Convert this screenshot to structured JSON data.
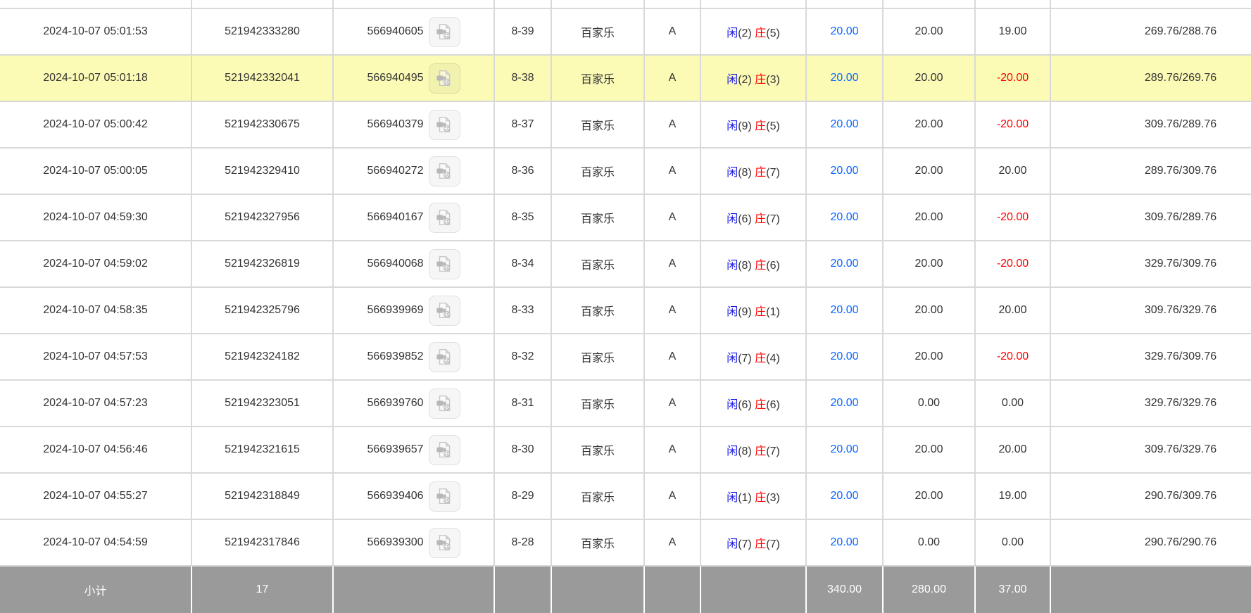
{
  "colors": {
    "highlight_row": "#fbfbb6",
    "bet_amount_blue": "#0a66ff",
    "player_blue": "#1414e6",
    "banker_red": "#ff0000",
    "negative_red": "#ff0000",
    "summary_bg": "#9a9a9a",
    "summary_text": "#ffffff",
    "grid_border": "#d9d9d9"
  },
  "icons": {
    "video_replay": "video-file-icon"
  },
  "table": {
    "rows": [
      {
        "time": "2024-10-07 05:01:53",
        "order_no": "521942333280",
        "game_no": "566940605",
        "round": "8-39",
        "game": "百家乐",
        "table": "A",
        "player_label": "闲",
        "player_score": "(2)",
        "banker_label": "庄",
        "banker_score": "(5)",
        "bet": "20.00",
        "valid": "20.00",
        "win_loss": "19.00",
        "balance": "269.76/288.76",
        "highlighted": false
      },
      {
        "time": "2024-10-07 05:01:18",
        "order_no": "521942332041",
        "game_no": "566940495",
        "round": "8-38",
        "game": "百家乐",
        "table": "A",
        "player_label": "闲",
        "player_score": "(2)",
        "banker_label": "庄",
        "banker_score": "(3)",
        "bet": "20.00",
        "valid": "20.00",
        "win_loss": "-20.00",
        "balance": "289.76/269.76",
        "highlighted": true
      },
      {
        "time": "2024-10-07 05:00:42",
        "order_no": "521942330675",
        "game_no": "566940379",
        "round": "8-37",
        "game": "百家乐",
        "table": "A",
        "player_label": "闲",
        "player_score": "(9)",
        "banker_label": "庄",
        "banker_score": "(5)",
        "bet": "20.00",
        "valid": "20.00",
        "win_loss": "-20.00",
        "balance": "309.76/289.76",
        "highlighted": false
      },
      {
        "time": "2024-10-07 05:00:05",
        "order_no": "521942329410",
        "game_no": "566940272",
        "round": "8-36",
        "game": "百家乐",
        "table": "A",
        "player_label": "闲",
        "player_score": "(8)",
        "banker_label": "庄",
        "banker_score": "(7)",
        "bet": "20.00",
        "valid": "20.00",
        "win_loss": "20.00",
        "balance": "289.76/309.76",
        "highlighted": false
      },
      {
        "time": "2024-10-07 04:59:30",
        "order_no": "521942327956",
        "game_no": "566940167",
        "round": "8-35",
        "game": "百家乐",
        "table": "A",
        "player_label": "闲",
        "player_score": "(6)",
        "banker_label": "庄",
        "banker_score": "(7)",
        "bet": "20.00",
        "valid": "20.00",
        "win_loss": "-20.00",
        "balance": "309.76/289.76",
        "highlighted": false
      },
      {
        "time": "2024-10-07 04:59:02",
        "order_no": "521942326819",
        "game_no": "566940068",
        "round": "8-34",
        "game": "百家乐",
        "table": "A",
        "player_label": "闲",
        "player_score": "(8)",
        "banker_label": "庄",
        "banker_score": "(6)",
        "bet": "20.00",
        "valid": "20.00",
        "win_loss": "-20.00",
        "balance": "329.76/309.76",
        "highlighted": false
      },
      {
        "time": "2024-10-07 04:58:35",
        "order_no": "521942325796",
        "game_no": "566939969",
        "round": "8-33",
        "game": "百家乐",
        "table": "A",
        "player_label": "闲",
        "player_score": "(9)",
        "banker_label": "庄",
        "banker_score": "(1)",
        "bet": "20.00",
        "valid": "20.00",
        "win_loss": "20.00",
        "balance": "309.76/329.76",
        "highlighted": false
      },
      {
        "time": "2024-10-07 04:57:53",
        "order_no": "521942324182",
        "game_no": "566939852",
        "round": "8-32",
        "game": "百家乐",
        "table": "A",
        "player_label": "闲",
        "player_score": "(7)",
        "banker_label": "庄",
        "banker_score": "(4)",
        "bet": "20.00",
        "valid": "20.00",
        "win_loss": "-20.00",
        "balance": "329.76/309.76",
        "highlighted": false
      },
      {
        "time": "2024-10-07 04:57:23",
        "order_no": "521942323051",
        "game_no": "566939760",
        "round": "8-31",
        "game": "百家乐",
        "table": "A",
        "player_label": "闲",
        "player_score": "(6)",
        "banker_label": "庄",
        "banker_score": "(6)",
        "bet": "20.00",
        "valid": "0.00",
        "win_loss": "0.00",
        "balance": "329.76/329.76",
        "highlighted": false
      },
      {
        "time": "2024-10-07 04:56:46",
        "order_no": "521942321615",
        "game_no": "566939657",
        "round": "8-30",
        "game": "百家乐",
        "table": "A",
        "player_label": "闲",
        "player_score": "(8)",
        "banker_label": "庄",
        "banker_score": "(7)",
        "bet": "20.00",
        "valid": "20.00",
        "win_loss": "20.00",
        "balance": "309.76/329.76",
        "highlighted": false
      },
      {
        "time": "2024-10-07 04:55:27",
        "order_no": "521942318849",
        "game_no": "566939406",
        "round": "8-29",
        "game": "百家乐",
        "table": "A",
        "player_label": "闲",
        "player_score": "(1)",
        "banker_label": "庄",
        "banker_score": "(3)",
        "bet": "20.00",
        "valid": "20.00",
        "win_loss": "19.00",
        "balance": "290.76/309.76",
        "highlighted": false
      },
      {
        "time": "2024-10-07 04:54:59",
        "order_no": "521942317846",
        "game_no": "566939300",
        "round": "8-28",
        "game": "百家乐",
        "table": "A",
        "player_label": "闲",
        "player_score": "(7)",
        "banker_label": "庄",
        "banker_score": "(7)",
        "bet": "20.00",
        "valid": "0.00",
        "win_loss": "0.00",
        "balance": "290.76/290.76",
        "highlighted": false
      }
    ],
    "summary": {
      "label": "小计",
      "count": "17",
      "bet_total": "340.00",
      "valid_total": "280.00",
      "win_loss_total": "37.00"
    }
  }
}
